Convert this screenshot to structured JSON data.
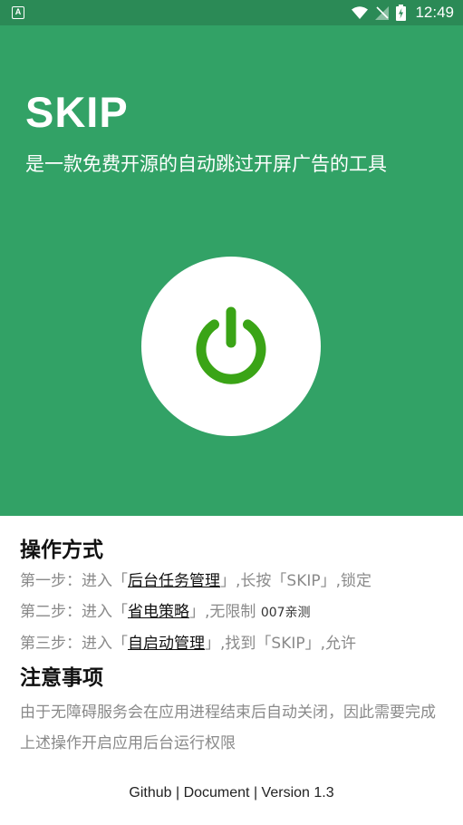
{
  "status_bar": {
    "time": "12:49",
    "left_icon": "A",
    "icons": [
      "wifi-icon",
      "signal-off-icon",
      "battery-charging-icon"
    ]
  },
  "header": {
    "title": "SKIP",
    "subtitle": "是一款免费开源的自动跳过开屏广告的工具"
  },
  "power_button": {
    "icon": "power-icon",
    "color": "#3aa416"
  },
  "usage": {
    "title": "操作方式",
    "steps": [
      {
        "prefix": "第一步：进入「",
        "link": "后台任务管理",
        "suffix": "」,长按「SKIP」,锁定",
        "note": ""
      },
      {
        "prefix": "第二步：进入「",
        "link": "省电策略",
        "suffix": "」,无限制 ",
        "note": "007亲测"
      },
      {
        "prefix": "第三步：进入「",
        "link": "自启动管理",
        "suffix": "」,找到「SKIP」,允许",
        "note": ""
      }
    ]
  },
  "notes": {
    "title": "注意事项",
    "text": "由于无障碍服务会在应用进程结束后自动关闭，因此需要完成上述操作开启应用后台运行权限"
  },
  "footer": {
    "github": "Github",
    "document": "Document",
    "version": "Version 1.3",
    "separator": " | "
  },
  "colors": {
    "status_bar": "#2b8a56",
    "hero": "#32a266",
    "power_icon": "#3aa416"
  }
}
